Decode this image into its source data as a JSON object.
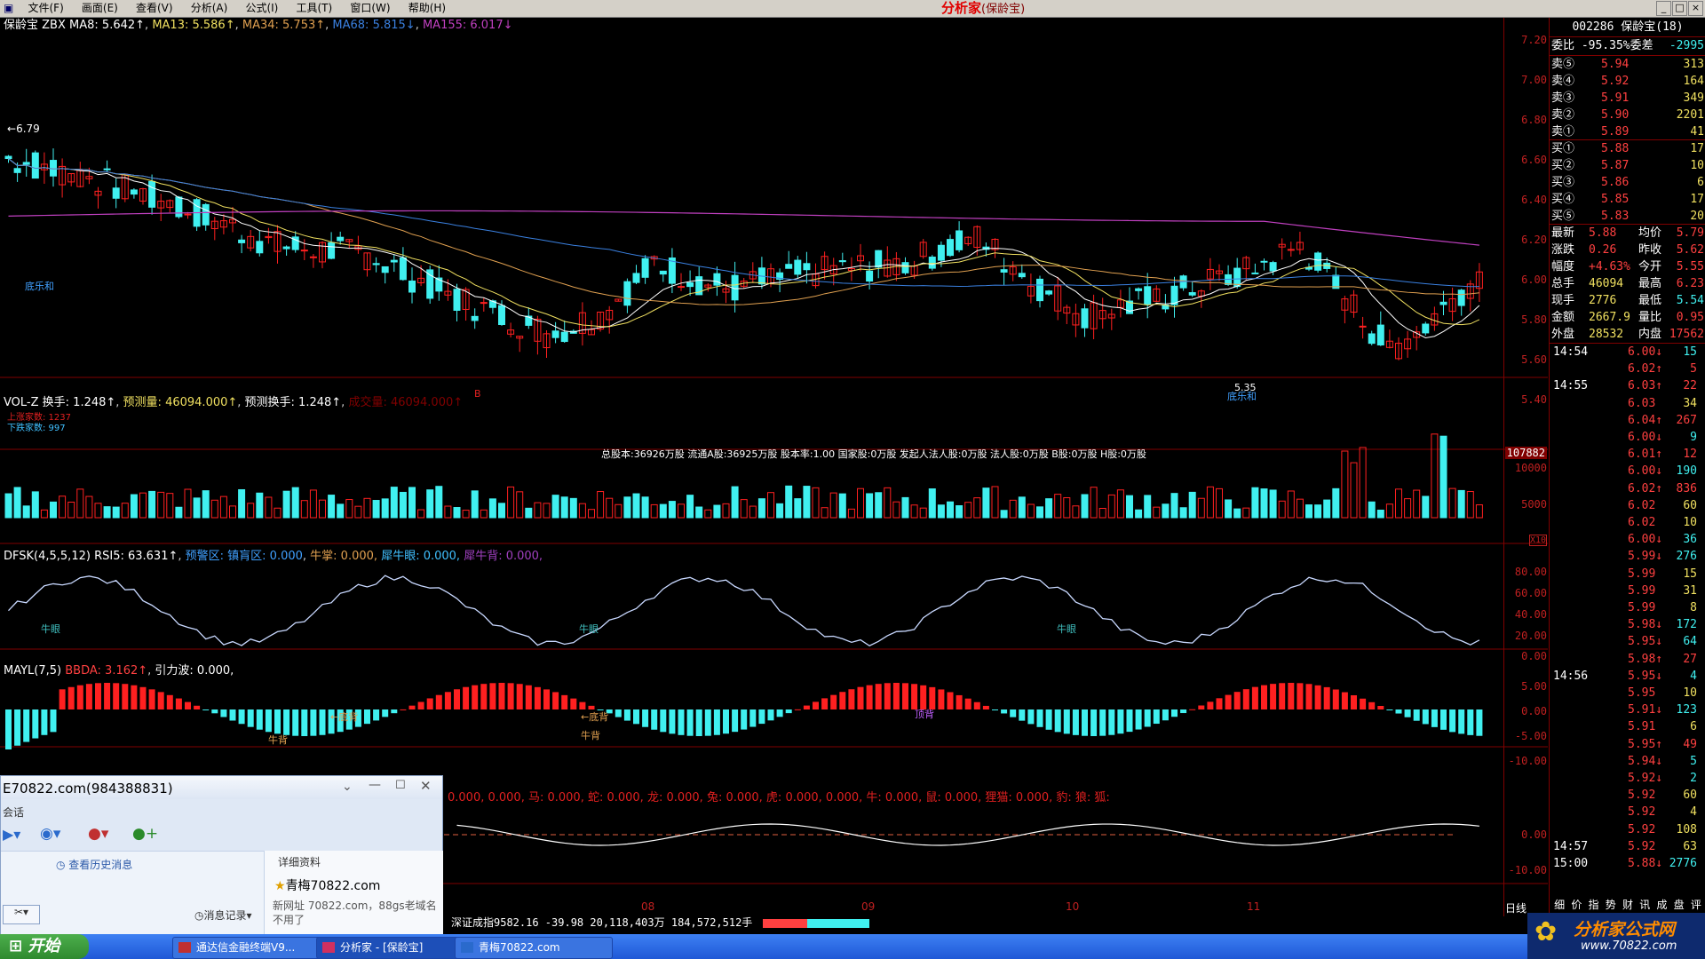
{
  "menu": {
    "items": [
      "文件(F)",
      "画面(E)",
      "查看(V)",
      "分析(A)",
      "公式(I)",
      "工具(T)",
      "窗口(W)",
      "帮助(H)"
    ],
    "app_title": "分析家",
    "app_subtitle": "(保龄宝)"
  },
  "window_buttons": [
    "_",
    "□",
    "×"
  ],
  "main_panel": {
    "stock": "保龄宝",
    "indicator": "ZBX",
    "ma8": "MA8: 5.642↑",
    "ma13": "MA13: 5.586↑",
    "ma34": "MA34: 5.753↑",
    "ma68": "MA68: 5.815↓",
    "ma155": "MA155: 6.017↓",
    "high_label": "6.79",
    "low_label": "5.35",
    "mark_left": "底乐和",
    "mark_bottom": "底乐和",
    "ticks": [
      "7.20",
      "7.00",
      "6.80",
      "6.60",
      "6.40",
      "6.20",
      "6.00",
      "5.80",
      "5.60",
      "5.40"
    ],
    "marker": "B"
  },
  "vol_panel": {
    "name": "VOL-Z",
    "turnover": "换手: 1.248↑",
    "pred_vol_label": "预测量:",
    "pred_vol": "46094.000↑",
    "pred_turn": "预测换手: 1.248↑",
    "vol": "成交量: 46094.000↑",
    "up_count": "上涨家数: 1237",
    "down_count": "下跌家数: 997",
    "shares_info": "总股本:36926万股  流通A股:36925万股  股本率:1.00  国家股:0万股  发起人法人股:0万股  法人股:0万股  B股:0万股  H股:0万股",
    "axis_top": "107882",
    "ticks": [
      "10000",
      "5000"
    ],
    "unit": "X10"
  },
  "dfsk_panel": {
    "name": "DFSK(4,5,5,12)",
    "rsi": "RSI5: 63.631↑",
    "warn": "预警区:",
    "calm": "镇肓区: 0.000",
    "niu": "牛掌: 0.000,",
    "xiniu": "犀牛眼: 0.000,",
    "xiniubei": "犀牛背: 0.000,",
    "labels": [
      "牛眼",
      "牛眼",
      "牛眼"
    ],
    "ticks": [
      "80.00",
      "60.00",
      "40.00",
      "20.00",
      "0.00"
    ]
  },
  "mayl_panel": {
    "name": "MAYL(7,5)",
    "bbda": "BBDA: 3.162↑",
    "force": "引力波: 0.000,",
    "labels": [
      "牛背",
      "←底背",
      "←底背",
      "牛背",
      "顶背"
    ],
    "ticks": [
      "5.00",
      "0.00",
      "-5.00",
      "-10.00"
    ]
  },
  "sixth_panel": {
    "legend": "0.000,  0.000, 马: 0.000, 蛇: 0.000, 龙: 0.000, 兔: 0.000, 虎: 0.000, 0.000, 牛: 0.000, 鼠: 0.000, 狸猫: 0.000, 豹: 狼: 狐:",
    "ticks": [
      "0.00",
      "-10.00"
    ]
  },
  "date_axis": [
    "08",
    "09",
    "10",
    "11"
  ],
  "period": "日线",
  "index_status": "深证成指9582.16  -39.98  20,118,403万  184,572,512手",
  "quote": {
    "header": "002286 保龄宝(18)",
    "weibi": "委比 -95.35%委差",
    "weicha": "-2995",
    "asks": [
      {
        "label": "卖⑤",
        "price": "5.94",
        "vol": "313"
      },
      {
        "label": "卖④",
        "price": "5.92",
        "vol": "164"
      },
      {
        "label": "卖③",
        "price": "5.91",
        "vol": "349"
      },
      {
        "label": "卖②",
        "price": "5.90",
        "vol": "2201"
      },
      {
        "label": "卖①",
        "price": "5.89",
        "vol": "41"
      }
    ],
    "bids": [
      {
        "label": "买①",
        "price": "5.88",
        "vol": "17"
      },
      {
        "label": "买②",
        "price": "5.87",
        "vol": "10"
      },
      {
        "label": "买③",
        "price": "5.86",
        "vol": "6"
      },
      {
        "label": "买④",
        "price": "5.85",
        "vol": "17"
      },
      {
        "label": "买⑤",
        "price": "5.83",
        "vol": "20"
      }
    ],
    "stats": [
      {
        "l1": "最新",
        "v1": "5.88",
        "l2": "均价",
        "v2": "5.79"
      },
      {
        "l1": "涨跌",
        "v1": "0.26",
        "l2": "昨收",
        "v2": "5.62"
      },
      {
        "l1": "幅度",
        "v1": "+4.63%",
        "l2": "今开",
        "v2": "5.55"
      },
      {
        "l1": "总手",
        "v1": "46094",
        "l2": "最高",
        "v2": "6.23"
      },
      {
        "l1": "现手",
        "v1": "2776",
        "l2": "最低",
        "v2": "5.54"
      },
      {
        "l1": "金额",
        "v1": "2667.9",
        "l2": "量比",
        "v2": "0.95"
      },
      {
        "l1": "外盘",
        "v1": "28532",
        "l2": "内盘",
        "v2": "17562"
      }
    ],
    "ticks": [
      {
        "t": "14:54",
        "p": "6.00↓",
        "v": "15"
      },
      {
        "t": "",
        "p": "6.02↑",
        "v": "5"
      },
      {
        "t": "14:55",
        "p": "6.03↑",
        "v": "22"
      },
      {
        "t": "",
        "p": "6.03",
        "v": "34"
      },
      {
        "t": "",
        "p": "6.04↑",
        "v": "267"
      },
      {
        "t": "",
        "p": "6.00↓",
        "v": "9"
      },
      {
        "t": "",
        "p": "6.01↑",
        "v": "12"
      },
      {
        "t": "",
        "p": "6.00↓",
        "v": "190"
      },
      {
        "t": "",
        "p": "6.02↑",
        "v": "836"
      },
      {
        "t": "",
        "p": "6.02",
        "v": "60"
      },
      {
        "t": "",
        "p": "6.02",
        "v": "10"
      },
      {
        "t": "",
        "p": "6.00↓",
        "v": "36"
      },
      {
        "t": "",
        "p": "5.99↓",
        "v": "276"
      },
      {
        "t": "",
        "p": "5.99",
        "v": "15"
      },
      {
        "t": "",
        "p": "5.99",
        "v": "31"
      },
      {
        "t": "",
        "p": "5.99",
        "v": "8"
      },
      {
        "t": "",
        "p": "5.98↓",
        "v": "172"
      },
      {
        "t": "",
        "p": "5.95↓",
        "v": "64"
      },
      {
        "t": "",
        "p": "5.98↑",
        "v": "27"
      },
      {
        "t": "14:56",
        "p": "5.95↓",
        "v": "4"
      },
      {
        "t": "",
        "p": "5.95",
        "v": "10"
      },
      {
        "t": "",
        "p": "5.91↓",
        "v": "123"
      },
      {
        "t": "",
        "p": "5.91",
        "v": "6"
      },
      {
        "t": "",
        "p": "5.95↑",
        "v": "49"
      },
      {
        "t": "",
        "p": "5.94↓",
        "v": "5"
      },
      {
        "t": "",
        "p": "5.92↓",
        "v": "2"
      },
      {
        "t": "",
        "p": "5.92",
        "v": "60"
      },
      {
        "t": "",
        "p": "5.92",
        "v": "4"
      },
      {
        "t": "",
        "p": "5.92",
        "v": "108"
      },
      {
        "t": "14:57",
        "p": "5.92",
        "v": "63"
      },
      {
        "t": "15:00",
        "p": "5.88↓",
        "v": "2776"
      }
    ],
    "tabs": "细 价 指 势 财 讯 成 盘 评"
  },
  "chat": {
    "title": "E70822.com(984388831)",
    "session": "会话",
    "history": "查看历史消息",
    "details": "详细资料",
    "contact": "青梅70822.com",
    "note": "新网址 70822.com，88gs老域名不用了",
    "msg_log": "消息记录"
  },
  "taskbar": {
    "start": "开始",
    "tasks": [
      "通达信金融终端V9...",
      "分析家 - [保龄宝]",
      "青梅70822.com"
    ]
  },
  "logo": {
    "name": "分析家公式网",
    "url": "www.70822.com"
  },
  "colors": {
    "up": "#ff2020",
    "down": "#40f0f0",
    "ma8": "#ffffff",
    "ma13": "#f0e060",
    "ma34": "#e0a050",
    "ma68": "#3a80e0",
    "ma155": "#c040c0"
  }
}
